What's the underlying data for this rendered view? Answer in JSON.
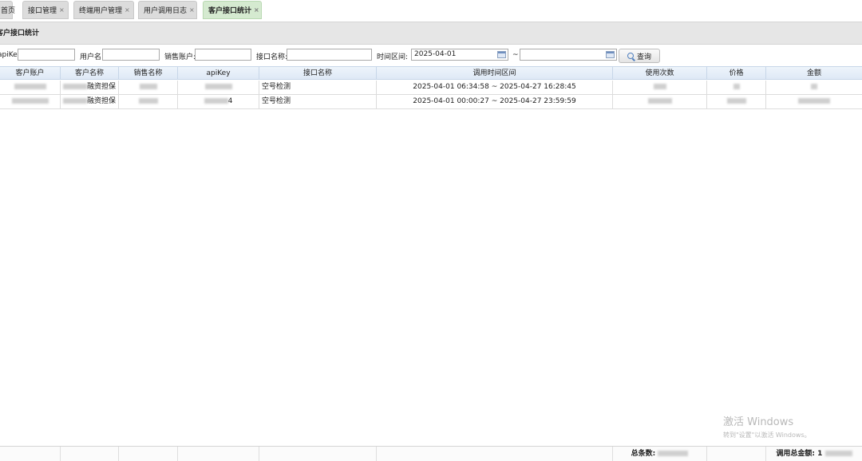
{
  "tabs": [
    {
      "label": "首页",
      "closable": false
    },
    {
      "label": "接口管理",
      "closable": true
    },
    {
      "label": "终端用户管理",
      "closable": true
    },
    {
      "label": "用户调用日志",
      "closable": true
    },
    {
      "label": "客户接口统计",
      "closable": true,
      "active": true
    }
  ],
  "tab_close_glyph": "×",
  "page_title": "客户接口统计",
  "filters": {
    "apikey_label": "apiKey:",
    "apikey_value": "",
    "username_label": "用户名",
    "username_value": "",
    "sales_label": "销售账户:",
    "sales_value": "",
    "api_name_label": "接口名称:",
    "api_name_value": "",
    "time_label": "时间区间:",
    "time_start": "2025-04-01",
    "time_sep": "~",
    "time_end": "",
    "query_label": "查询"
  },
  "table": {
    "columns": [
      "客户账户",
      "客户名称",
      "销售名称",
      "apiKey",
      "接口名称",
      "调用时间区间",
      "使用次数",
      "价格",
      "金额"
    ],
    "rows": [
      {
        "account": "",
        "name_suffix": "融资担保",
        "sales": "",
        "apikey": "",
        "api_name": "空号检测",
        "time_range": "2025-04-01 06:34:58 ~ 2025-04-27 16:28:45",
        "count": "",
        "price": "",
        "amount": ""
      },
      {
        "account": "",
        "name_suffix": "融资担保",
        "sales": "",
        "apikey": "4",
        "api_name": "空号检测",
        "time_range": "2025-04-01 00:00:27 ~ 2025-04-27 23:59:59",
        "count": "",
        "price": "",
        "amount": ""
      }
    ]
  },
  "footer": {
    "total_rows_label": "总条数:",
    "total_amount_label": "调用总金额: 1"
  },
  "watermark": {
    "line1": "激活 Windows",
    "line2": "转到\"设置\"以激活 Windows。"
  },
  "icons": {
    "query": "search-icon",
    "calendar": "calendar-icon",
    "tab_close": "close-icon"
  }
}
